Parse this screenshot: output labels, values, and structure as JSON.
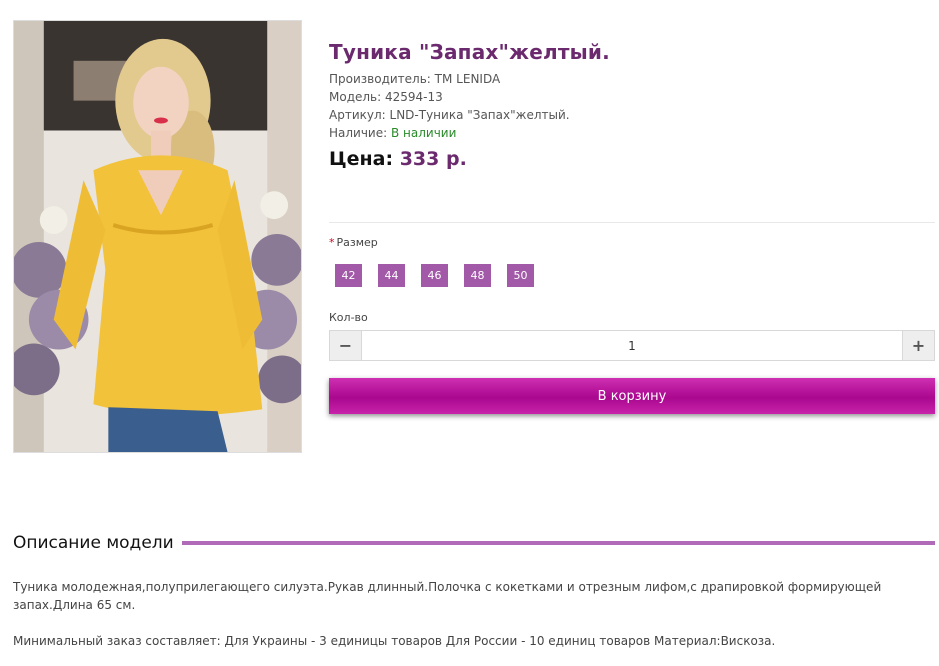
{
  "product": {
    "title": "Туника \"Запах\"желтый.",
    "image_alt": "Yellow wrap tunic worn by model",
    "manufacturer_label": "Производитель:",
    "manufacturer": "TM LENIDA",
    "model_label": "Модель:",
    "model": "42594-13",
    "article_label": "Артикул:",
    "article": "LND-Туника \"Запах\"желтый.",
    "availability_label": "Наличие:",
    "availability": "В наличии",
    "price_label": "Цена:",
    "price": "333 р."
  },
  "options": {
    "size_label": "Размер",
    "required_mark": "*",
    "sizes": [
      "42",
      "44",
      "46",
      "48",
      "50"
    ]
  },
  "quantity": {
    "label": "Кол-во",
    "value": "1",
    "minus": "−",
    "plus": "+"
  },
  "cart": {
    "button_label": "В корзину"
  },
  "description": {
    "heading": "Описание модели",
    "paragraph_1": "Туника молодежная,полуприлегающего силуэта.Рукав длинный.Полочка с кокетками и отрезным лифом,с драпировкой формирующей запах.Длина 65 см.",
    "paragraph_2": "Минимальный заказ составляет: Для Украины - 3 единицы товаров Для России - 10 единиц товаров Материал:Вискоза."
  },
  "colors": {
    "title": "#6b2a6e",
    "size_button": "#a259a8",
    "cart_button": "#b3109a",
    "heading_line": "#b06ab8",
    "in_stock": "#2a8a2a"
  }
}
